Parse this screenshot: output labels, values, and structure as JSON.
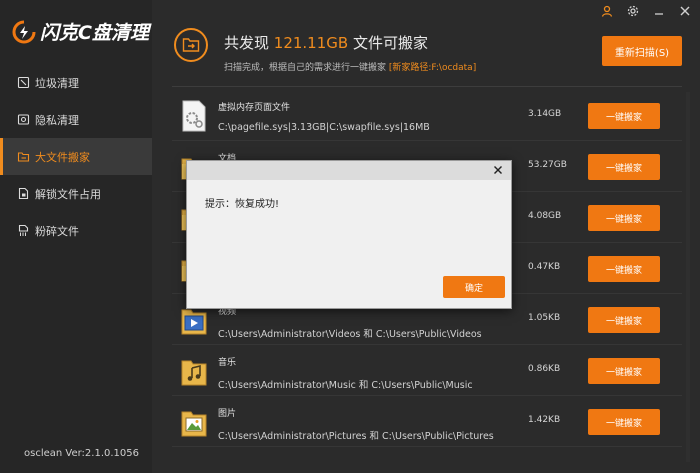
{
  "app": {
    "logo_text": "闪克C盘清理",
    "version": "osclean Ver:2.1.0.1056"
  },
  "sidebar": {
    "items": [
      {
        "label": "垃圾清理",
        "icon": "broom-icon"
      },
      {
        "label": "隐私清理",
        "icon": "privacy-icon"
      },
      {
        "label": "大文件搬家",
        "icon": "folder-move-icon",
        "active": true
      },
      {
        "label": "解锁文件占用",
        "icon": "unlock-file-icon"
      },
      {
        "label": "粉碎文件",
        "icon": "shred-file-icon"
      }
    ]
  },
  "header": {
    "title_prefix": "共发现 ",
    "title_size": "121.11GB",
    "title_suffix": " 文件可搬家",
    "subtitle": "扫描完成，根据自己的需求进行一键搬家 ",
    "path_label": "[新家路径:F:\\ocdata]",
    "rescan_label": "重新扫描(S)"
  },
  "files": [
    {
      "name": "虚拟内存页面文件",
      "path": "C:\\pagefile.sys|3.13GB|C:\\swapfile.sys|16MB",
      "size": "3.14GB",
      "icon": "gear-file-icon",
      "button": "一键搬家"
    },
    {
      "name": "文档",
      "path": "",
      "size": "53.27GB",
      "icon": "folder-icon",
      "button": "一键搬家"
    },
    {
      "name": "",
      "path": "",
      "size": "4.08GB",
      "icon": "folder-icon",
      "button": "一键搬家"
    },
    {
      "name": "",
      "path": "",
      "size": "0.47KB",
      "icon": "folder-icon",
      "button": "一键搬家"
    },
    {
      "name": "视频",
      "path": "C:\\Users\\Administrator\\Videos 和 C:\\Users\\Public\\Videos",
      "size": "1.05KB",
      "icon": "video-folder-icon",
      "button": "一键搬家"
    },
    {
      "name": "音乐",
      "path": "C:\\Users\\Administrator\\Music 和 C:\\Users\\Public\\Music",
      "size": "0.86KB",
      "icon": "music-folder-icon",
      "button": "一键搬家"
    },
    {
      "name": "图片",
      "path": "C:\\Users\\Administrator\\Pictures 和 C:\\Users\\Public\\Pictures",
      "size": "1.42KB",
      "icon": "picture-folder-icon",
      "button": "一键搬家"
    }
  ],
  "dialog": {
    "message": "提示：恢复成功!",
    "ok_label": "确定"
  },
  "colors": {
    "accent": "#f07812",
    "background": "#2b2b2b",
    "sidebar": "#262626"
  }
}
